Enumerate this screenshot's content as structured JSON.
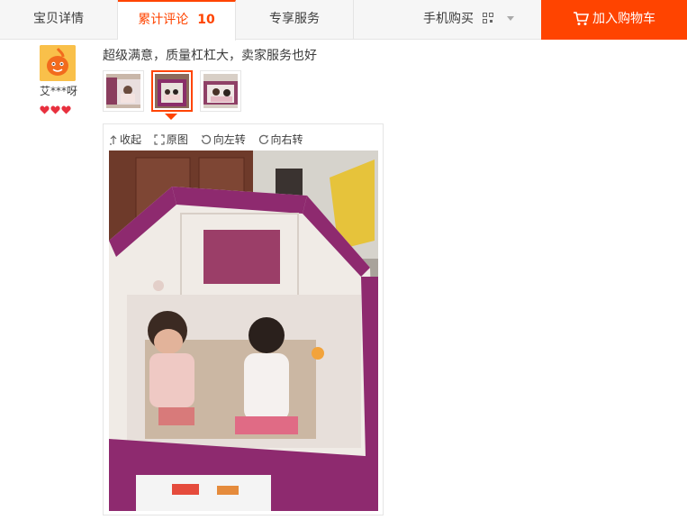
{
  "tabs": {
    "details": "宝贝详情",
    "reviews_label": "累计评论",
    "reviews_count": "10",
    "services": "专享服务"
  },
  "header": {
    "mobile_buy": "手机购买",
    "add_to_cart": "加入购物车"
  },
  "review": {
    "username": "艾***呀",
    "text": "超级满意，质量杠杠大，卖家服务也好",
    "thumbnail_count": 3,
    "selected_thumbnail": 2
  },
  "viewer": {
    "collapse": "收起",
    "original": "原图",
    "rotate_left": "向左转",
    "rotate_right": "向右转"
  },
  "colors": {
    "accent": "#ff4400",
    "tab_bg": "#f6f6f6",
    "border": "#e5e5e5"
  },
  "icons": [
    "cart-icon",
    "qr-code-icon",
    "chevron-down-icon",
    "collapse-icon",
    "fullscreen-icon",
    "rotate-left-icon",
    "rotate-right-icon",
    "heart-badge-icon"
  ]
}
